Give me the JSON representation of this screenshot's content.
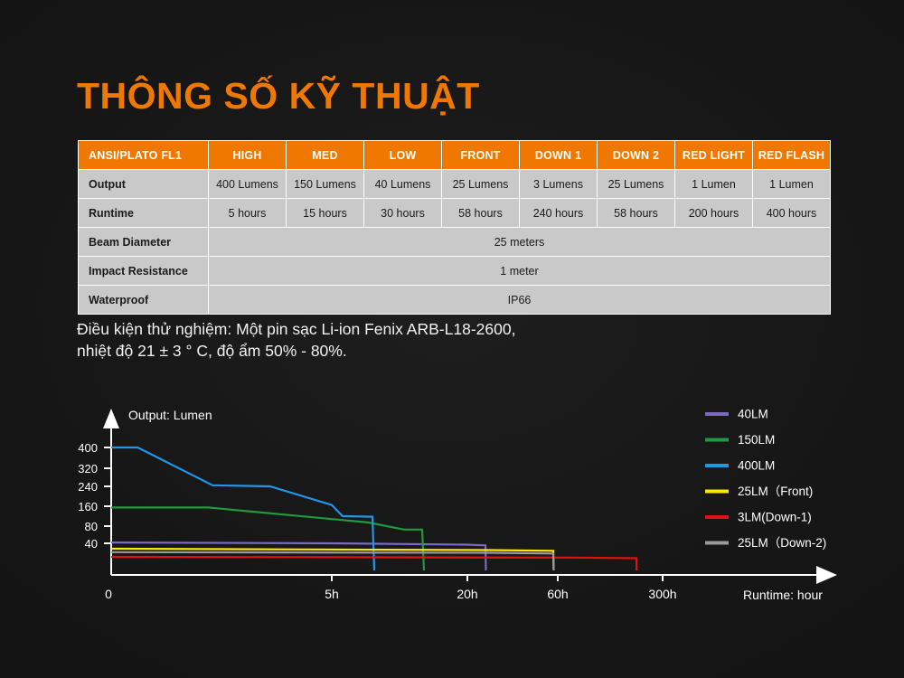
{
  "page": {
    "title": "THÔNG SỐ KỸ THUẬT",
    "title_color": "#F07800",
    "background_color": "#141414"
  },
  "spec_table": {
    "headers": [
      "ANSI/PLATO FL1",
      "HIGH",
      "MED",
      "LOW",
      "FRONT",
      "DOWN 1",
      "DOWN 2",
      "RED LIGHT",
      "RED FLASH"
    ],
    "rows": [
      {
        "label": "Output",
        "cells": [
          "400 Lumens",
          "150 Lumens",
          "40 Lumens",
          "25 Lumens",
          "3 Lumens",
          "25 Lumens",
          "1 Lumen",
          "1 Lumen"
        ]
      },
      {
        "label": "Runtime",
        "cells": [
          "5 hours",
          "15 hours",
          "30 hours",
          "58 hours",
          "240 hours",
          "58 hours",
          "200 hours",
          "400 hours"
        ]
      }
    ],
    "merged_rows": [
      {
        "label": "Beam Diameter",
        "value": "25 meters"
      },
      {
        "label": "Impact Resistance",
        "value": "1 meter"
      },
      {
        "label": "Waterproof",
        "value": "IP66"
      }
    ],
    "header_bg": "#F07800",
    "cell_bg": "#C9C9C9"
  },
  "note": {
    "line1": "Điều kiện thử nghiệm: Một pin sạc Li-ion Fenix ARB-L18-2600,",
    "line2": "nhiệt độ 21 ± 3 ° C, độ ẩm 50% - 80%."
  },
  "chart_data": {
    "type": "line",
    "title": "",
    "ylabel": "Output: Lumen",
    "xlabel": "Runtime: hour",
    "yticks": [
      40,
      80,
      160,
      240,
      320,
      400
    ],
    "ytick_labels": [
      "40",
      "80",
      "160",
      "240",
      "320",
      "400"
    ],
    "xticks": [
      0,
      5,
      20,
      60,
      300
    ],
    "xtick_labels": [
      "0",
      "5h",
      "20h",
      "60h",
      "300h"
    ],
    "grid": false,
    "legend_position": "right",
    "series": [
      {
        "name": "40LM",
        "color": "#7B6BC4",
        "points": [
          [
            0,
            42
          ],
          [
            5,
            40
          ],
          [
            20,
            38
          ],
          [
            28,
            37
          ],
          [
            28.2,
            0
          ]
        ],
        "runtime_end_h": 28
      },
      {
        "name": "150LM",
        "color": "#1E9B3C",
        "points": [
          [
            0,
            155
          ],
          [
            2.2,
            155
          ],
          [
            9,
            95
          ],
          [
            13,
            72
          ],
          [
            15,
            72
          ],
          [
            15.2,
            0
          ]
        ],
        "runtime_end_h": 15
      },
      {
        "name": "400LM",
        "color": "#2196E8",
        "points": [
          [
            0,
            400
          ],
          [
            0.6,
            400
          ],
          [
            2.3,
            245
          ],
          [
            3.6,
            240
          ],
          [
            5,
            165
          ],
          [
            6.2,
            120
          ],
          [
            9.5,
            118
          ],
          [
            9.7,
            0
          ]
        ],
        "runtime_end_h": 5
      },
      {
        "name": "25LM（Front)",
        "color": "#FFE800",
        "points": [
          [
            0,
            32
          ],
          [
            30,
            30
          ],
          [
            58,
            29
          ],
          [
            58.2,
            0
          ]
        ],
        "runtime_end_h": 58
      },
      {
        "name": "3LM(Down-1)",
        "color": "#DE1212",
        "points": [
          [
            0,
            20
          ],
          [
            100,
            19
          ],
          [
            240,
            18
          ],
          [
            240.5,
            0
          ]
        ],
        "runtime_end_h": 240
      },
      {
        "name": "25LM（Down-2)",
        "color": "#9A9A9A",
        "points": [
          [
            0,
            27
          ],
          [
            30,
            26
          ],
          [
            58,
            25
          ],
          [
            58.2,
            0
          ]
        ],
        "runtime_end_h": 58
      }
    ]
  }
}
